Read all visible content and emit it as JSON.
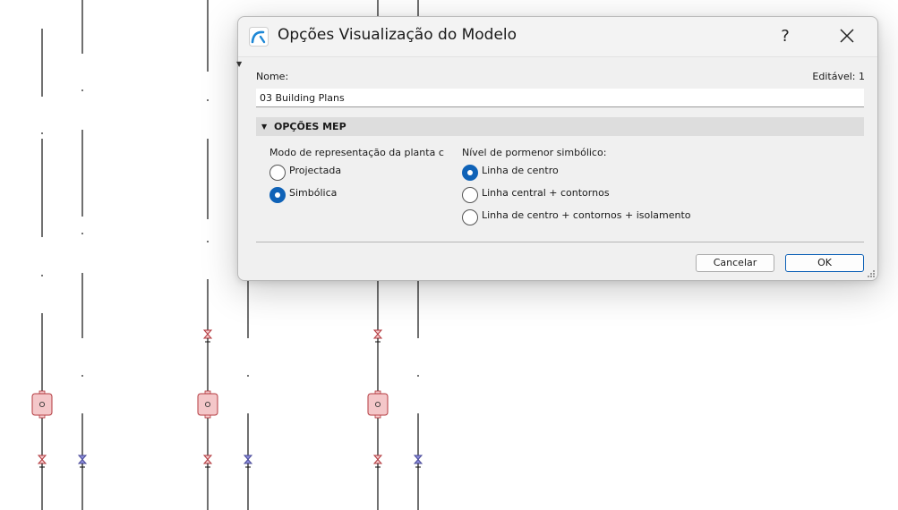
{
  "dialog": {
    "title": "Opções Visualização do Modelo",
    "help_label": "?",
    "name_label": "Nome:",
    "editable_label": "Editável: 1",
    "name_value": "03 Building Plans",
    "section_title": "OPÇÕES MEP",
    "left_group": {
      "label": "Modo de representação da planta c",
      "options": [
        {
          "label": "Projectada",
          "checked": false
        },
        {
          "label": "Simbólica",
          "checked": true
        }
      ]
    },
    "right_group": {
      "label": "Nível de pormenor simbólico:",
      "options": [
        {
          "label": "Linha de centro",
          "checked": true
        },
        {
          "label": "Linha central + contornos",
          "checked": false
        },
        {
          "label": "Linha de centro + contornos + isolamento",
          "checked": false
        }
      ]
    },
    "cancel_label": "Cancelar",
    "ok_label": "OK"
  },
  "colors": {
    "accent": "#0f62b7",
    "fitting_fill": "#f4c7c9",
    "fitting_stroke": "#b33a3f",
    "valve_blue": "#8b8cd9"
  },
  "icons": {
    "app": "archicad-arch-icon",
    "help": "question-mark",
    "close": "close-x-icon"
  }
}
